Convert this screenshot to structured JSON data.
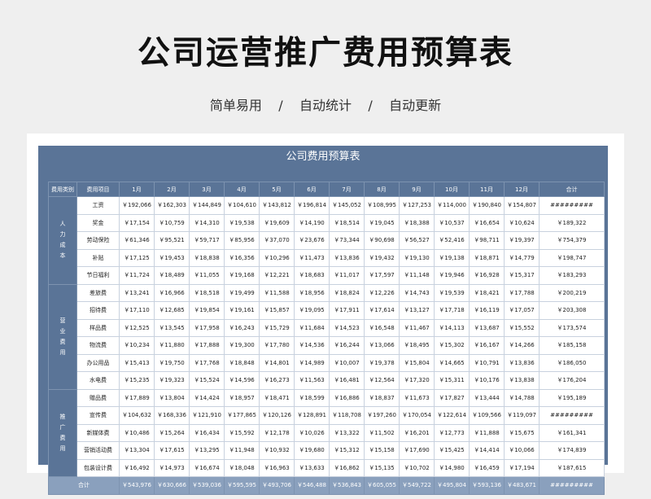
{
  "header": {
    "title": "公司运营推广费用预算表",
    "subtitle": "简单易用    /    自动统计    /    自动更新"
  },
  "sheet": {
    "title": "公司费用预算表",
    "columns": [
      "费用类别",
      "费用项目",
      "1月",
      "2月",
      "3月",
      "4月",
      "5月",
      "6月",
      "7月",
      "8月",
      "9月",
      "10月",
      "11月",
      "12月",
      "合计"
    ],
    "categories": [
      {
        "name": "人力成本",
        "rows": [
          {
            "item": "工资",
            "values": [
              "￥192,066",
              "￥162,303",
              "￥144,849",
              "￥104,610",
              "￥143,812",
              "￥196,814",
              "￥145,052",
              "￥108,995",
              "￥127,253",
              "￥114,000",
              "￥190,840",
              "￥154,807",
              "#########"
            ]
          },
          {
            "item": "奖金",
            "values": [
              "￥17,154",
              "￥10,759",
              "￥14,310",
              "￥19,538",
              "￥19,609",
              "￥14,190",
              "￥18,514",
              "￥19,045",
              "￥18,388",
              "￥10,537",
              "￥16,654",
              "￥10,624",
              "￥189,322"
            ]
          },
          {
            "item": "劳动保险",
            "values": [
              "￥61,346",
              "￥95,521",
              "￥59,717",
              "￥85,956",
              "￥37,070",
              "￥23,676",
              "￥73,344",
              "￥90,698",
              "￥56,527",
              "￥52,416",
              "￥98,711",
              "￥19,397",
              "￥754,379"
            ]
          },
          {
            "item": "补贴",
            "values": [
              "￥17,125",
              "￥19,453",
              "￥18,838",
              "￥16,356",
              "￥10,296",
              "￥11,473",
              "￥13,836",
              "￥19,432",
              "￥19,130",
              "￥19,138",
              "￥18,871",
              "￥14,779",
              "￥198,747"
            ]
          },
          {
            "item": "节日福利",
            "values": [
              "￥11,724",
              "￥18,489",
              "￥11,055",
              "￥19,168",
              "￥12,221",
              "￥18,683",
              "￥11,017",
              "￥17,597",
              "￥11,148",
              "￥19,946",
              "￥16,928",
              "￥15,317",
              "￥183,293"
            ]
          }
        ]
      },
      {
        "name": "营业费用",
        "rows": [
          {
            "item": "差旅费",
            "values": [
              "￥13,241",
              "￥16,966",
              "￥18,518",
              "￥19,499",
              "￥11,588",
              "￥18,956",
              "￥18,824",
              "￥12,226",
              "￥14,743",
              "￥19,539",
              "￥18,421",
              "￥17,788",
              "￥200,219"
            ]
          },
          {
            "item": "招待费",
            "values": [
              "￥17,110",
              "￥12,685",
              "￥19,854",
              "￥19,161",
              "￥15,857",
              "￥19,095",
              "￥17,911",
              "￥17,614",
              "￥13,127",
              "￥17,718",
              "￥16,119",
              "￥17,057",
              "￥203,308"
            ]
          },
          {
            "item": "样品费",
            "values": [
              "￥12,525",
              "￥13,545",
              "￥17,958",
              "￥16,243",
              "￥15,729",
              "￥11,684",
              "￥14,523",
              "￥16,548",
              "￥11,467",
              "￥14,113",
              "￥13,687",
              "￥15,552",
              "￥173,574"
            ]
          },
          {
            "item": "物流费",
            "values": [
              "￥10,234",
              "￥11,880",
              "￥17,888",
              "￥19,300",
              "￥17,780",
              "￥14,536",
              "￥16,244",
              "￥13,066",
              "￥18,495",
              "￥15,302",
              "￥16,167",
              "￥14,266",
              "￥185,158"
            ]
          },
          {
            "item": "办公用品",
            "values": [
              "￥15,413",
              "￥19,750",
              "￥17,768",
              "￥18,848",
              "￥14,801",
              "￥14,989",
              "￥10,007",
              "￥19,378",
              "￥15,804",
              "￥14,665",
              "￥10,791",
              "￥13,836",
              "￥186,050"
            ]
          },
          {
            "item": "水电费",
            "values": [
              "￥15,235",
              "￥19,323",
              "￥15,524",
              "￥14,596",
              "￥16,273",
              "￥11,563",
              "￥16,481",
              "￥12,564",
              "￥17,320",
              "￥15,311",
              "￥10,176",
              "￥13,838",
              "￥176,204"
            ]
          }
        ]
      },
      {
        "name": "推广费用",
        "rows": [
          {
            "item": "赠品费",
            "values": [
              "￥17,889",
              "￥13,804",
              "￥14,424",
              "￥18,957",
              "￥18,471",
              "￥18,599",
              "￥16,886",
              "￥18,837",
              "￥11,673",
              "￥17,827",
              "￥13,444",
              "￥14,788",
              "￥195,189"
            ]
          },
          {
            "item": "宣传费",
            "values": [
              "￥104,632",
              "￥168,336",
              "￥121,910",
              "￥177,865",
              "￥120,126",
              "￥128,891",
              "￥118,708",
              "￥197,260",
              "￥170,054",
              "￥122,614",
              "￥109,566",
              "￥119,097",
              "#########"
            ]
          },
          {
            "item": "新媒体费",
            "values": [
              "￥10,486",
              "￥15,264",
              "￥16,434",
              "￥15,592",
              "￥12,178",
              "￥10,026",
              "￥13,322",
              "￥11,502",
              "￥16,201",
              "￥12,773",
              "￥11,888",
              "￥15,675",
              "￥161,341"
            ]
          },
          {
            "item": "营销活动费",
            "values": [
              "￥13,304",
              "￥17,615",
              "￥13,295",
              "￥11,948",
              "￥10,932",
              "￥19,680",
              "￥15,312",
              "￥15,158",
              "￥17,690",
              "￥15,425",
              "￥14,414",
              "￥10,066",
              "￥174,839"
            ]
          },
          {
            "item": "包装设计费",
            "values": [
              "￥16,492",
              "￥14,973",
              "￥16,674",
              "￥18,048",
              "￥16,963",
              "￥13,633",
              "￥16,862",
              "￥15,135",
              "￥10,702",
              "￥14,980",
              "￥16,459",
              "￥17,194",
              "￥187,615"
            ]
          }
        ]
      }
    ],
    "total": {
      "label": "合计",
      "values": [
        "￥543,976",
        "￥630,666",
        "￥539,036",
        "￥595,595",
        "￥493,706",
        "￥546,488",
        "￥536,843",
        "￥605,055",
        "￥549,722",
        "￥495,804",
        "￥593,136",
        "￥483,671",
        "#########"
      ]
    }
  }
}
